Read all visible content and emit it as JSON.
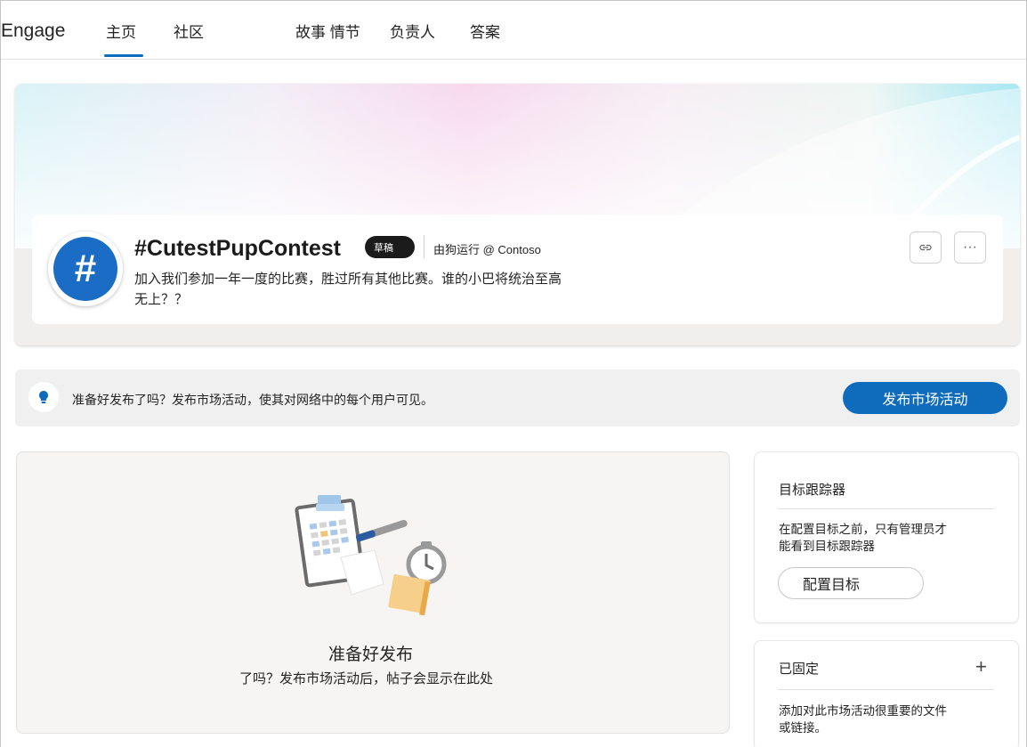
{
  "app": {
    "brand": "Engage"
  },
  "nav": [
    {
      "label": "主页",
      "active": true
    },
    {
      "label": "社区"
    },
    {
      "label": "故事 情节"
    },
    {
      "label": "负责人"
    },
    {
      "label": "答案"
    }
  ],
  "campaign": {
    "avatar_symbol": "#",
    "title": "#CutestPupContest",
    "status_badge": "草稿",
    "run_by": "由狗运行 @ Contoso",
    "description": "加入我们参加一年一度的比赛，胜过所有其他比赛。谁的小巴将统治至高无上？？"
  },
  "actions": {
    "link_icon": "link-icon",
    "more_icon": "more-icon",
    "more_glyph": "···"
  },
  "publish_banner": {
    "text": "准备好发布了吗？发布市场活动，使其对网络中的每个用户可见。",
    "button": "发布市场活动"
  },
  "feed": {
    "empty_title": "准备好发布",
    "empty_subtitle": "了吗？发布市场活动后，帖子会显示在此处"
  },
  "goal_tracker": {
    "title": "目标跟踪器",
    "text": "在配置目标之前，只有管理员才能看到目标跟踪器",
    "button": "配置目标"
  },
  "pinned": {
    "title": "已固定",
    "add_glyph": "+",
    "text": "添加对此市场活动很重要的文件或链接。"
  },
  "colors": {
    "accent": "#0f6cbd",
    "avatar": "#1a6cc4",
    "badge": "#1b1b1b"
  }
}
